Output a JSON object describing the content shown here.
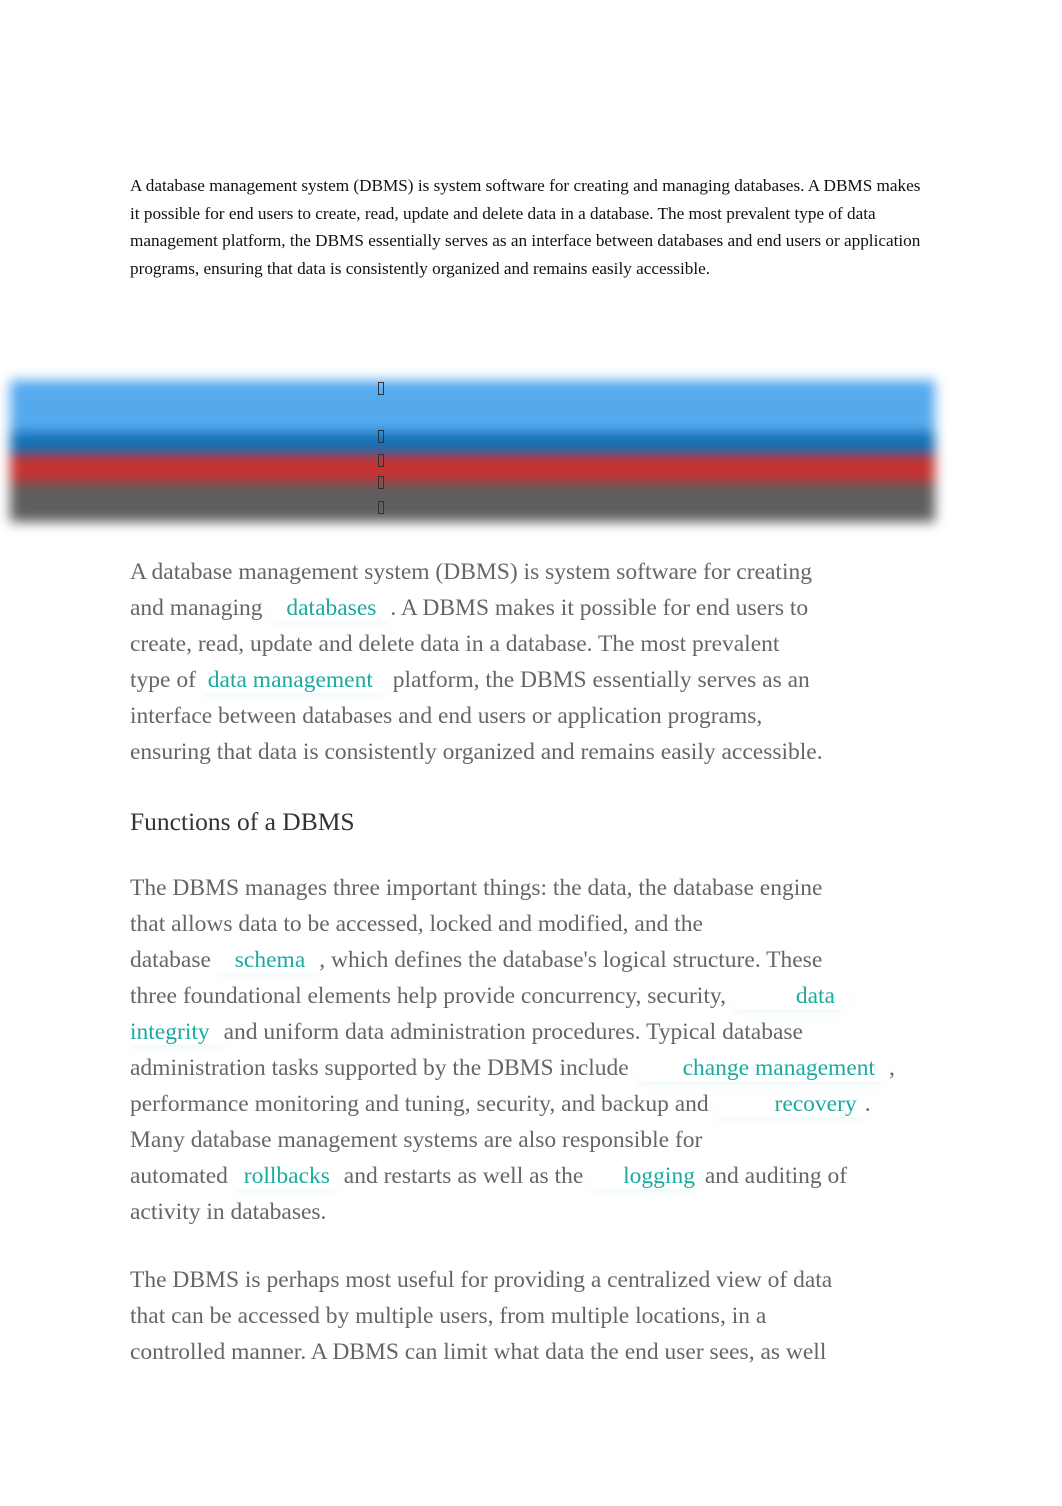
{
  "summary": "A database management system (DBMS) is system software for creating and managing databases. A DBMS makes it possible for end users to create, read, update and delete data in a database. The most prevalent type of data management platform, the DBMS essentially serves as an interface between databases and end users or application programs, ensuring that data is consistently organized and remains easily accessible.",
  "share_bar": {
    "colors": [
      "#55aaee",
      "#1570b5",
      "#c83232",
      "#5e5e5e"
    ],
    "icons": [
      "share-icon-1",
      "share-icon-2",
      "share-icon-3",
      "share-icon-4",
      "share-icon-5"
    ]
  },
  "article": {
    "intro": {
      "l1": "A database management system (DBMS) is system software for creating",
      "l2_pre": "and managing",
      "l2_link": "databases",
      "l2_post": ". A DBMS makes it possible for end users to",
      "l3": "create, read, update and delete data in a database. The most prevalent",
      "l4_pre": "type of",
      "l4_link": "data management",
      "l4_post": "platform, the DBMS essentially serves as an",
      "l5": "interface between databases and end users or application programs,",
      "l6": "ensuring that data is consistently organized and remains easily accessible."
    },
    "heading": "Functions of a DBMS",
    "functions": {
      "l1": "The DBMS manages three important things: the data, the database engine",
      "l2": "that allows data to be accessed, locked and modified, and the",
      "l3_pre": "database",
      "l3_link": "schema",
      "l3_post": ", which defines the database's logical structure. These",
      "l4_pre": "three foundational elements help provide concurrency, security,",
      "l4_link": "data",
      "l5_link": "integrity",
      "l5_post": "and uniform data administration procedures. Typical database",
      "l6_pre": "administration tasks supported by the DBMS include",
      "l6_link": "change management",
      "l6_post": ",",
      "l7_pre": "performance monitoring and tuning, security, and backup and",
      "l7_link": "recovery",
      "l7_post": ".",
      "l8": "Many database management systems are also responsible for",
      "l9_pre": "automated",
      "l9_link1": "rollbacks",
      "l9_mid": "and restarts as well as the",
      "l9_link2": "logging",
      "l9_post": "and auditing of",
      "l10": "activity in databases."
    },
    "centralized": {
      "l1": "The DBMS is perhaps most useful for providing a centralized view of data",
      "l2": "that can be accessed by multiple users, from multiple locations, in a",
      "l3": "controlled manner. A DBMS can limit what data the end user sees, as well"
    },
    "link_color": "#1aaaa0",
    "text_color": "#666666"
  }
}
